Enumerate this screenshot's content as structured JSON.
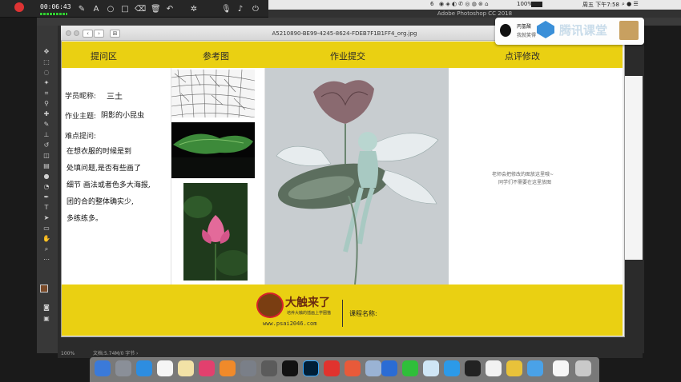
{
  "recorder": {
    "time": "00:06:43"
  },
  "menubar": {
    "battery": "100%",
    "clock": "周五 下午7:58",
    "app_badge": "6"
  },
  "photoshop": {
    "title": "Adobe Photoshop CC 2018",
    "status_zoom": "100%",
    "status_doc": "文档:5.74M/0 字节"
  },
  "window": {
    "title": "A5210890-BE99-4245-8624-FDEB7F1B1FF4_org.jpg"
  },
  "document": {
    "headers": [
      "提问区",
      "参考图",
      "作业提交",
      "点评修改"
    ],
    "student_label": "学员昵称:",
    "student_name": "三土",
    "topic_label": "作业主题:",
    "topic_value": "阴影的小昆虫",
    "difficulty_label": "难点提问:",
    "question": "在想衣服的时候是到\n处填问题,是否有些画了\n细节 画法或者色多大海报,\n团的合的整体确实少,\n多练练多。",
    "review_note_1": "老师会把修改的图放这里哦~",
    "review_note_2": "同学们不需要在这里放图",
    "brand_name": "大触来了",
    "brand_slogan": "培养大触的插画上学圈猫",
    "brand_url": "www.psai2046.com",
    "course_label": "课程名称:"
  },
  "qq_notification": {
    "name": "丙氢酸",
    "status": "我就笑得",
    "banner": "腾讯课堂"
  }
}
